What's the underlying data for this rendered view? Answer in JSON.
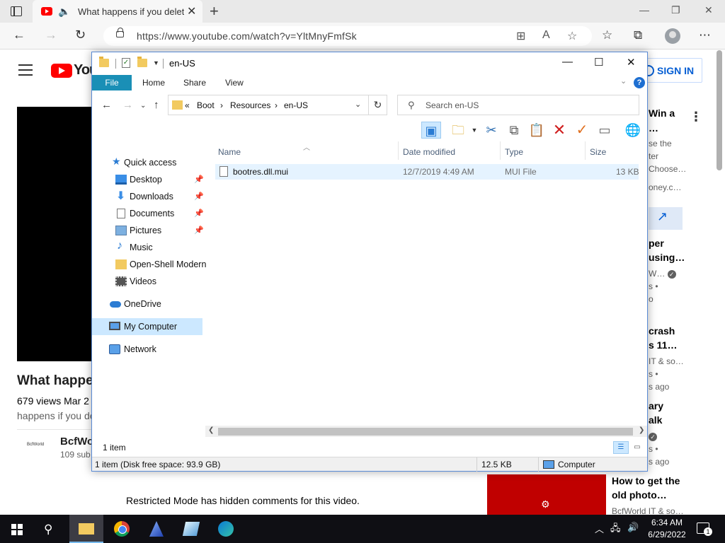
{
  "browser": {
    "tab_title": "What happens if you delete",
    "url": "https://www.youtube.com/watch?v=YltMnyFmfSk"
  },
  "youtube": {
    "logo_text": "You",
    "sign_in": "SIGN IN",
    "video_title": "What happen",
    "views": "679 views  Mar 2",
    "desc": "happens if you de",
    "channel_name": "BcfWor",
    "channel_subs": "109 sub",
    "channel_logo_text": "BcfWorld",
    "restricted": "Restricted Mode has hidden comments for this video.",
    "sidebar": [
      {
        "title1": "Win a",
        "title2": "…",
        "meta1": "se the",
        "meta2": "ter",
        "meta3": "Choose…",
        "meta4": "oney.c…"
      },
      {
        "title1": "per",
        "title2": "using…",
        "meta1": "W…",
        "meta2": "s •",
        "meta3": "o"
      },
      {
        "title1": "crash",
        "title2": "s 11…",
        "meta1": "IT & so…",
        "meta2": "s •",
        "meta3": "s ago"
      },
      {
        "title1": "ary",
        "title2": "alk",
        "meta1": "s •",
        "meta2": "s ago"
      },
      {
        "title1": "How to get the",
        "title2": "old photo…",
        "meta1": "BcfWorld IT & so…"
      }
    ]
  },
  "explorer": {
    "title": "en-US",
    "ribbon_tabs": [
      "File",
      "Home",
      "Share",
      "View"
    ],
    "help": "?",
    "breadcrumb": [
      "«",
      "Boot",
      "›",
      "Resources",
      "›",
      "en-US"
    ],
    "search_placeholder": "Search en-US",
    "nav": {
      "quick_access": "Quick access",
      "desktop": "Desktop",
      "downloads": "Downloads",
      "documents": "Documents",
      "pictures": "Pictures",
      "music": "Music",
      "openshell": "Open-Shell Modern",
      "videos": "Videos",
      "onedrive": "OneDrive",
      "mycomputer": "My Computer",
      "network": "Network"
    },
    "columns": {
      "name": "Name",
      "date": "Date modified",
      "type": "Type",
      "size": "Size"
    },
    "files": [
      {
        "name": "bootres.dll.mui",
        "date": "12/7/2019 4:49 AM",
        "type": "MUI File",
        "size": "13 KB"
      }
    ],
    "item_count": "1 item",
    "status": {
      "summary": "1 item (Disk free space: 93.9 GB)",
      "size": "12.5 KB",
      "location": "Computer"
    }
  },
  "taskbar": {
    "time": "6:34 AM",
    "date": "6/29/2022",
    "notifications": "1"
  }
}
